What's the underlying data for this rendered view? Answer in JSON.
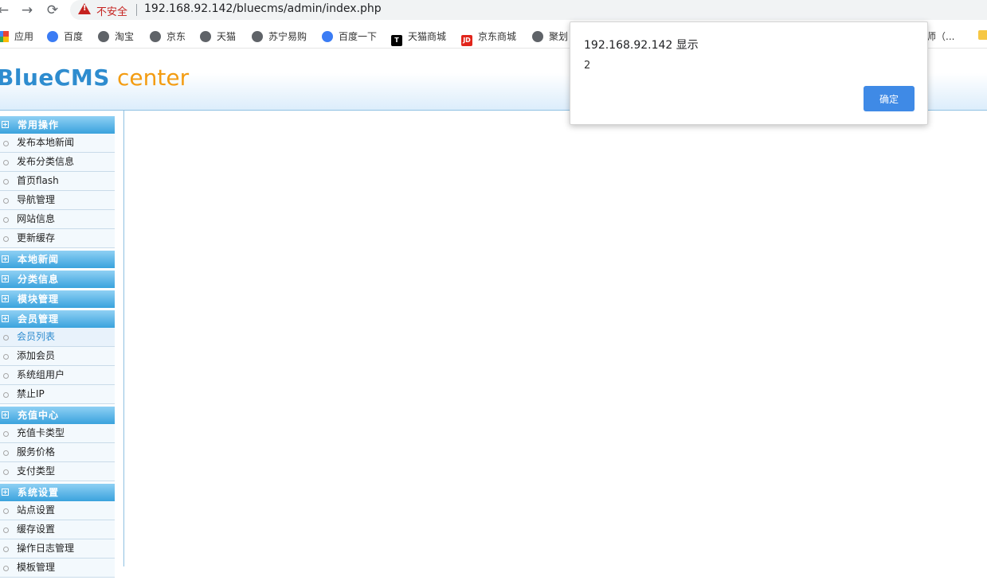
{
  "browser": {
    "nav": {
      "back": "←",
      "forward": "→",
      "reload": "⟳"
    },
    "security_label": "不安全",
    "url": "192.168.92.142/bluecms/admin/index.php",
    "bookmarks": [
      {
        "label": "应用",
        "icon": "apps-grid-icon"
      },
      {
        "label": "百度",
        "icon": "baidu-paw-icon"
      },
      {
        "label": "淘宝",
        "icon": "globe-icon"
      },
      {
        "label": "京东",
        "icon": "globe-icon"
      },
      {
        "label": "天猫",
        "icon": "globe-icon"
      },
      {
        "label": "苏宁易购",
        "icon": "globe-icon"
      },
      {
        "label": "百度一下",
        "icon": "baidu-paw-icon"
      },
      {
        "label": "天猫商城",
        "icon": "tmall-icon"
      },
      {
        "label": "京东商城",
        "icon": "jd-icon"
      },
      {
        "label": "聚划",
        "icon": "globe-icon"
      },
      {
        "label": "师（...",
        "icon": ""
      }
    ]
  },
  "header": {
    "logo_main": "BlueCMS",
    "logo_sub": "center"
  },
  "sidebar": {
    "sections": [
      {
        "title": "常用操作",
        "items": [
          "发布本地新闻",
          "发布分类信息",
          "首页flash",
          "导航管理",
          "网站信息",
          "更新缓存"
        ]
      },
      {
        "title": "本地新闻",
        "items": []
      },
      {
        "title": "分类信息",
        "items": []
      },
      {
        "title": "模块管理",
        "items": []
      },
      {
        "title": "会员管理",
        "items": [
          "会员列表",
          "添加会员",
          "系统组用户",
          "禁止IP"
        ]
      },
      {
        "title": "充值中心",
        "items": [
          "充值卡类型",
          "服务价格",
          "支付类型"
        ]
      },
      {
        "title": "系统设置",
        "items": [
          "站点设置",
          "缓存设置",
          "操作日志管理",
          "模板管理"
        ]
      }
    ],
    "active_item": "会员列表"
  },
  "dialog": {
    "title": "192.168.92.142 显示",
    "message": "2",
    "ok_label": "确定"
  },
  "colors": {
    "accent": "#3aa3dd",
    "logo_blue": "#2e8ccf",
    "logo_orange": "#f39c12",
    "insecure_red": "#c5221f",
    "dialog_button": "#3f8ae6"
  }
}
